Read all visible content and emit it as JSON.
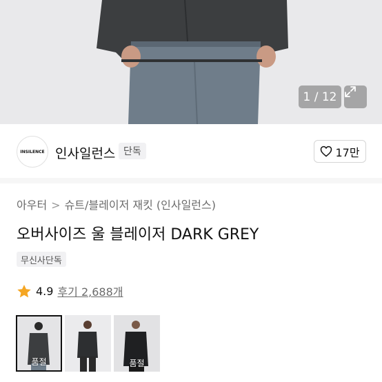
{
  "hero": {
    "counter": "1 / 12",
    "expand_icon": "expand-icon"
  },
  "brand": {
    "logo_text": "INSILENCE",
    "name": "인사일런스",
    "badge": "단독",
    "likes": "17만",
    "like_icon": "heart-outline-icon"
  },
  "breadcrumb": {
    "level1": "아우터",
    "separator": ">",
    "level2": "슈트/블레이저 재킷 (인사일런스)"
  },
  "product": {
    "title": "오버사이즈 울 블레이저 DARK GREY",
    "tag": "무신사단독",
    "rating": "4.9",
    "reviews": "후기 2,688개",
    "star_color": "#f5a623"
  },
  "thumbnails": [
    {
      "label": "품절",
      "selected": true
    },
    {
      "label": ""
    },
    {
      "label": "품절"
    }
  ]
}
